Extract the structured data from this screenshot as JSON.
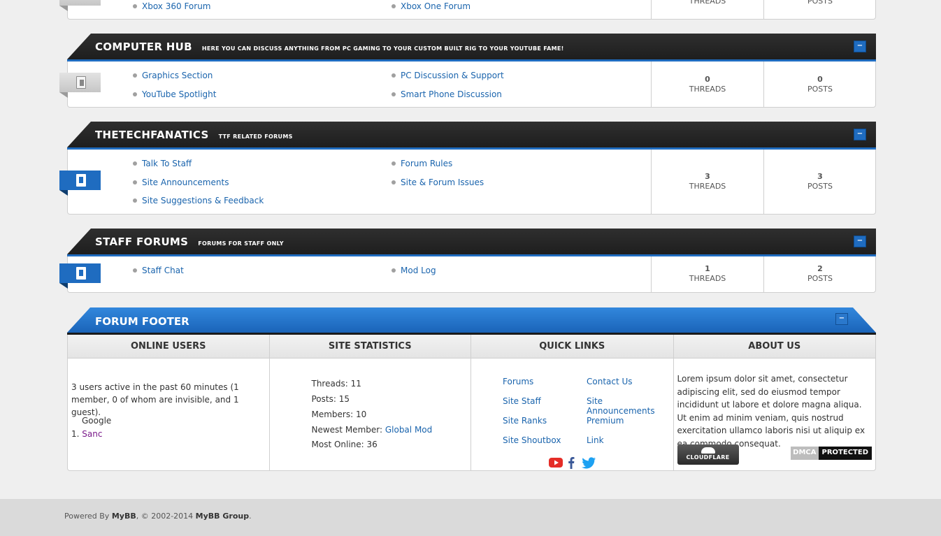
{
  "top_block": {
    "subforums": [
      "Xbox 360 Forum",
      "Xbox One Forum"
    ],
    "threads_label": "THREADS",
    "posts_label": "POSTS"
  },
  "categories": [
    {
      "title": "COMPUTER HUB",
      "description": "HERE YOU CAN DISCUSS ANYTHING FROM PC GAMING TO YOUR CUSTOM BUILT RIG TO YOUR YOUTUBE FAME!",
      "collapse": "−",
      "icon": "forum-read-icon",
      "subforums": [
        "Graphics Section",
        "PC Discussion & Support",
        "YouTube Spotlight",
        "Smart Phone Discussion"
      ],
      "threads": "0",
      "posts": "0",
      "threads_label": "THREADS",
      "posts_label": "POSTS"
    },
    {
      "title": "THETECHFANATICS",
      "description": "TTF RELATED FORUMS",
      "collapse": "−",
      "icon": "forum-new-posts-icon",
      "subforums": [
        "Talk To Staff",
        "Forum Rules",
        "Site Announcements",
        "Site & Forum Issues",
        "Site Suggestions & Feedback"
      ],
      "threads": "3",
      "posts": "3",
      "threads_label": "THREADS",
      "posts_label": "POSTS"
    },
    {
      "title": "STAFF FORUMS",
      "description": "FORUMS FOR STAFF ONLY",
      "collapse": "−",
      "icon": "forum-new-posts-icon",
      "subforums": [
        "Staff Chat",
        "Mod Log"
      ],
      "threads": "1",
      "posts": "2",
      "threads_label": "THREADS",
      "posts_label": "POSTS"
    }
  ],
  "footer": {
    "title": "FORUM FOOTER",
    "collapse": "−",
    "online_users": {
      "heading": "ONLINE USERS",
      "summary": "3 users active in the past 60 minutes (1 member, 0 of whom are invisible, and 1 guest).",
      "bot": "Google",
      "member_index": "1.",
      "member": "Sanc"
    },
    "site_statistics": {
      "heading": "SITE STATISTICS",
      "threads": "Threads: 11",
      "posts": "Posts: 15",
      "members": "Members: 10",
      "newest_label": "Newest Member: ",
      "newest_member": "Global Mod",
      "most_online": "Most Online: 36"
    },
    "quick_links": {
      "heading": "QUICK LINKS",
      "left": [
        "Forums",
        "Site Staff",
        "Site Ranks",
        "Site Shoutbox"
      ],
      "right": [
        "Contact Us",
        "Site Announcements",
        "Premium",
        "Link"
      ],
      "social": [
        "youtube-icon",
        "facebook-icon",
        "twitter-icon"
      ]
    },
    "about_us": {
      "heading": "ABOUT US",
      "text": "Lorem ipsum dolor sit amet, consectetur adipiscing elit, sed do eiusmod tempor incididunt ut labore et dolore magna aliqua. Ut enim ad minim veniam, quis nostrud exercitation ullamco laboris nisi ut aliquip ex ea commodo consequat.",
      "cloudflare": "CLOUDFLARE",
      "dmca_1": "DMCA",
      "dmca_2": "PROTECTED"
    }
  },
  "bottom": {
    "powered_prefix": "Powered By ",
    "mybb": "MyBB",
    "copyright": ", © 2002-2014 ",
    "group": "MyBB Group",
    "suffix": "."
  },
  "colors": {
    "accent_blue": "#1f6cc0",
    "header_dark": "#262626",
    "link": "#1a64ad",
    "member_purple": "#7a1a8a"
  }
}
